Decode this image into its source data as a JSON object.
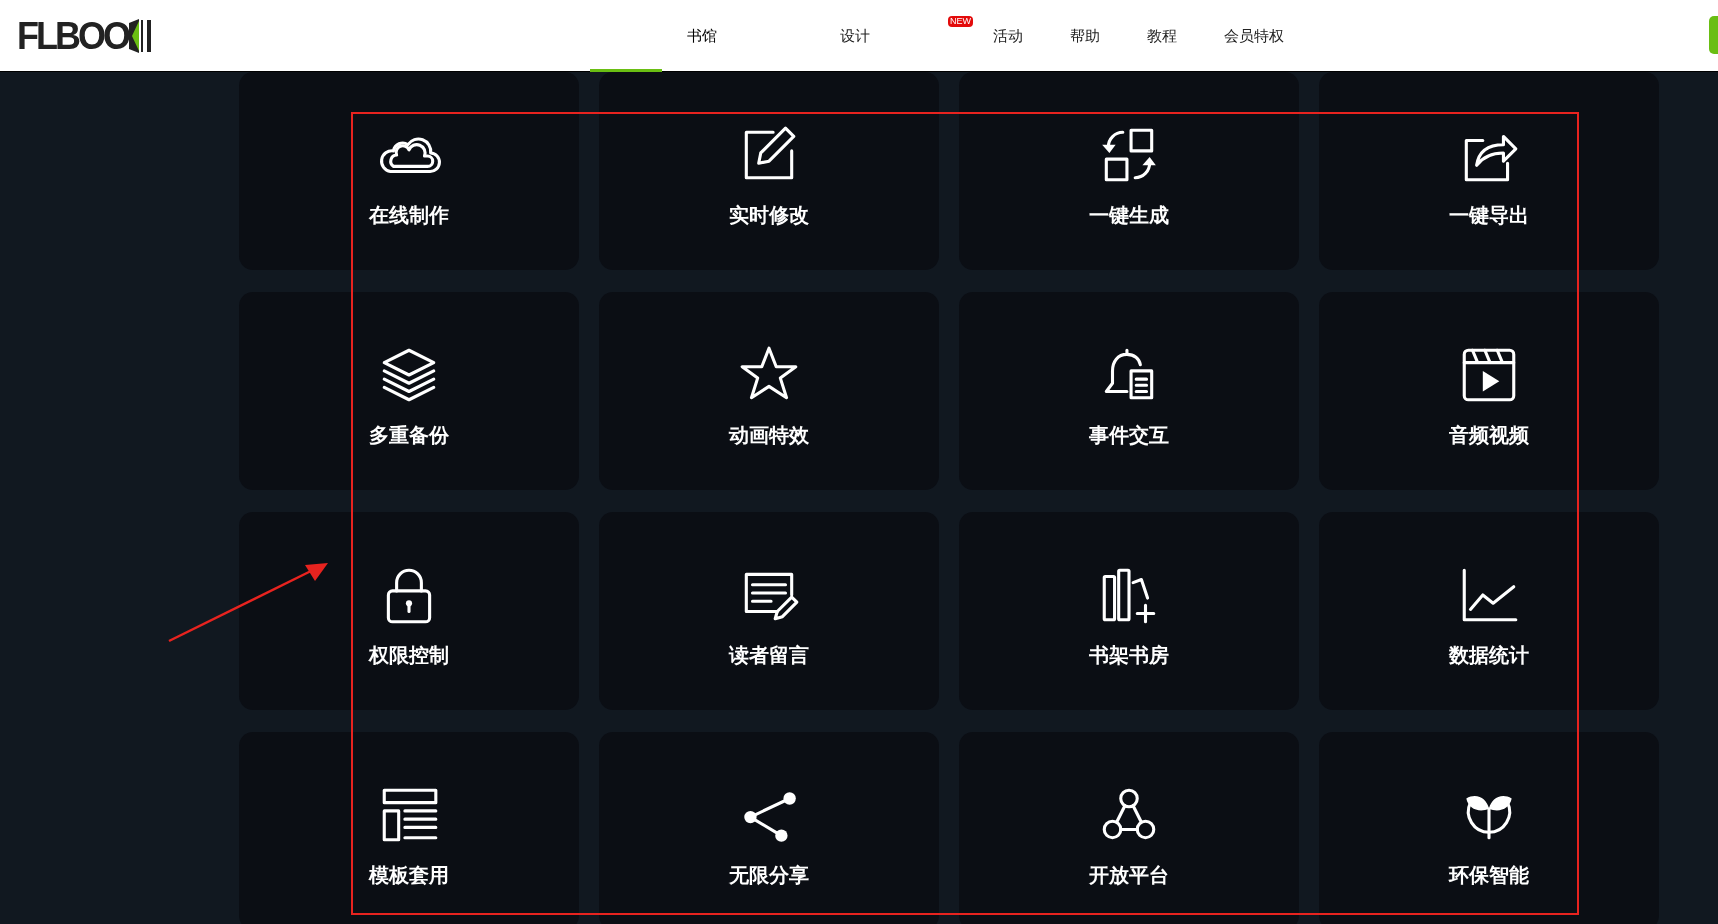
{
  "header": {
    "logo": "FLBOO",
    "nav": [
      {
        "label": "书馆",
        "selected": true
      },
      {
        "label": "设计",
        "selected": false
      },
      {
        "label": "活动",
        "selected": false,
        "badge": "NEW"
      },
      {
        "label": "帮助",
        "selected": false
      },
      {
        "label": "教程",
        "selected": false
      },
      {
        "label": "会员特权",
        "selected": false
      }
    ]
  },
  "features": [
    {
      "label": "在线制作"
    },
    {
      "label": "实时修改"
    },
    {
      "label": "一键生成"
    },
    {
      "label": "一键导出"
    },
    {
      "label": "多重备份"
    },
    {
      "label": "动画特效"
    },
    {
      "label": "事件交互"
    },
    {
      "label": "音频视频"
    },
    {
      "label": "权限控制"
    },
    {
      "label": "读者留言"
    },
    {
      "label": "书架书房"
    },
    {
      "label": "数据统计"
    },
    {
      "label": "模板套用"
    },
    {
      "label": "无限分享"
    },
    {
      "label": "开放平台"
    },
    {
      "label": "环保智能"
    }
  ]
}
